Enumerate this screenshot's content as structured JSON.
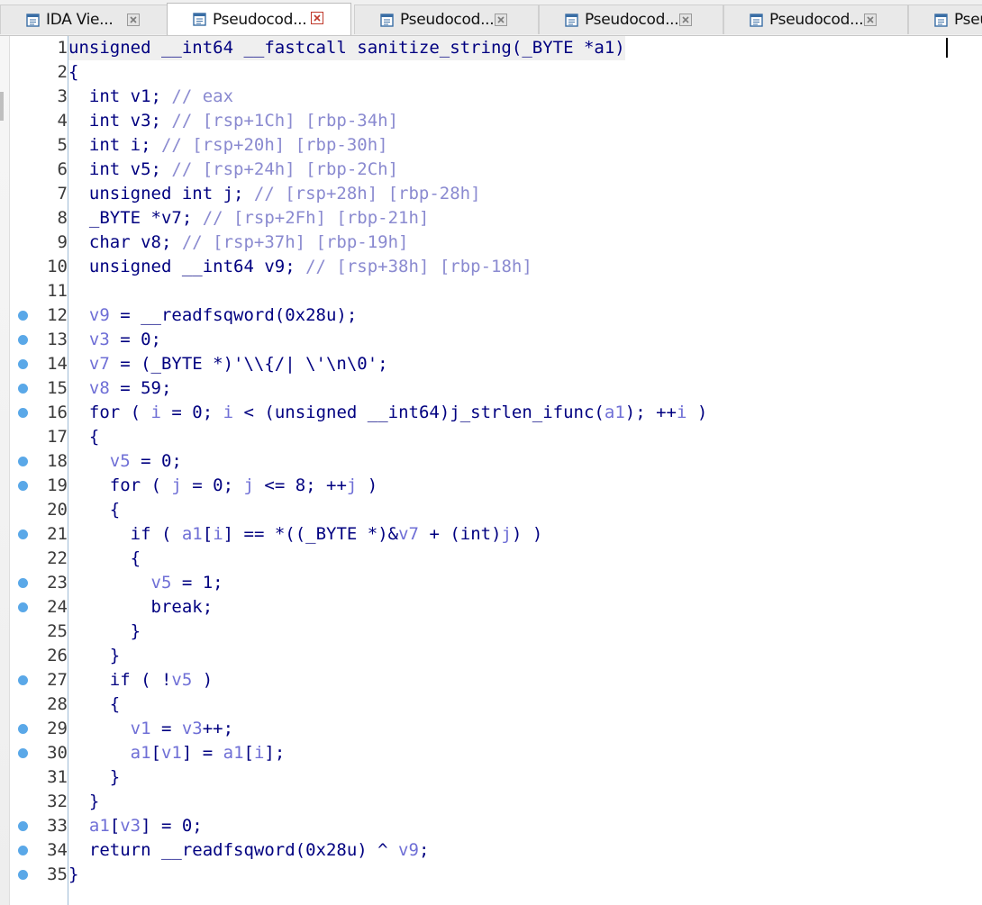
{
  "tabs": [
    {
      "label": "IDA Vie...",
      "active": false
    },
    {
      "label": "Pseudocod...",
      "active": true
    },
    {
      "label": "Pseudocod...",
      "active": false
    },
    {
      "label": "Pseudocod...",
      "active": false
    },
    {
      "label": "Pseudocod...",
      "active": false
    },
    {
      "label": "Pseu",
      "active": false
    }
  ],
  "colors": {
    "code_text": "#000080",
    "comment": "#8a8ad0",
    "variable": "#6f6fd6",
    "breakpoint_dot": "#5aa8e8",
    "active_close_border": "#c0392b"
  },
  "icons": {
    "tab_icon": "pseudocode-window-icon",
    "close": "close-icon",
    "line_marker": "breakpoint-dot-icon"
  },
  "code_lines": [
    {
      "no": "1",
      "dot": false,
      "segs": [
        [
          "k",
          "unsigned __int64 __fastcall sanitize_string(_BYTE *a1)"
        ]
      ]
    },
    {
      "no": "2",
      "dot": false,
      "segs": [
        [
          "p",
          "{"
        ]
      ]
    },
    {
      "no": "3",
      "dot": false,
      "segs": [
        [
          "k",
          "  int v1; "
        ],
        [
          "c",
          "// eax"
        ]
      ]
    },
    {
      "no": "4",
      "dot": false,
      "segs": [
        [
          "k",
          "  int v3; "
        ],
        [
          "c",
          "// [rsp+1Ch] [rbp-34h]"
        ]
      ]
    },
    {
      "no": "5",
      "dot": false,
      "segs": [
        [
          "k",
          "  int i; "
        ],
        [
          "c",
          "// [rsp+20h] [rbp-30h]"
        ]
      ]
    },
    {
      "no": "6",
      "dot": false,
      "segs": [
        [
          "k",
          "  int v5; "
        ],
        [
          "c",
          "// [rsp+24h] [rbp-2Ch]"
        ]
      ]
    },
    {
      "no": "7",
      "dot": false,
      "segs": [
        [
          "k",
          "  unsigned int j; "
        ],
        [
          "c",
          "// [rsp+28h] [rbp-28h]"
        ]
      ]
    },
    {
      "no": "8",
      "dot": false,
      "segs": [
        [
          "k",
          "  _BYTE *v7; "
        ],
        [
          "c",
          "// [rsp+2Fh] [rbp-21h]"
        ]
      ]
    },
    {
      "no": "9",
      "dot": false,
      "segs": [
        [
          "k",
          "  char v8; "
        ],
        [
          "c",
          "// [rsp+37h] [rbp-19h]"
        ]
      ]
    },
    {
      "no": "10",
      "dot": false,
      "segs": [
        [
          "k",
          "  unsigned __int64 v9; "
        ],
        [
          "c",
          "// [rsp+38h] [rbp-18h]"
        ]
      ]
    },
    {
      "no": "11",
      "dot": false,
      "segs": [
        [
          "p",
          ""
        ]
      ]
    },
    {
      "no": "12",
      "dot": true,
      "segs": [
        [
          "v",
          "  v9"
        ],
        [
          "p",
          " = __readfsqword(0x28u);"
        ]
      ]
    },
    {
      "no": "13",
      "dot": true,
      "segs": [
        [
          "v",
          "  v3"
        ],
        [
          "p",
          " = 0;"
        ]
      ]
    },
    {
      "no": "14",
      "dot": true,
      "segs": [
        [
          "v",
          "  v7"
        ],
        [
          "p",
          " = (_BYTE *)'\\\\{/| \\'\\n\\0';"
        ]
      ]
    },
    {
      "no": "15",
      "dot": true,
      "segs": [
        [
          "v",
          "  v8"
        ],
        [
          "p",
          " = 59;"
        ]
      ]
    },
    {
      "no": "16",
      "dot": true,
      "segs": [
        [
          "p",
          "  for ( "
        ],
        [
          "v",
          "i"
        ],
        [
          "p",
          " = 0; "
        ],
        [
          "v",
          "i"
        ],
        [
          "p",
          " < (unsigned __int64)j_strlen_ifunc("
        ],
        [
          "v",
          "a1"
        ],
        [
          "p",
          "); ++"
        ],
        [
          "v",
          "i"
        ],
        [
          "p",
          " )"
        ]
      ]
    },
    {
      "no": "17",
      "dot": false,
      "segs": [
        [
          "p",
          "  {"
        ]
      ]
    },
    {
      "no": "18",
      "dot": true,
      "segs": [
        [
          "v",
          "    v5"
        ],
        [
          "p",
          " = 0;"
        ]
      ]
    },
    {
      "no": "19",
      "dot": true,
      "segs": [
        [
          "p",
          "    for ( "
        ],
        [
          "v",
          "j"
        ],
        [
          "p",
          " = 0; "
        ],
        [
          "v",
          "j"
        ],
        [
          "p",
          " <= 8; ++"
        ],
        [
          "v",
          "j"
        ],
        [
          "p",
          " )"
        ]
      ]
    },
    {
      "no": "20",
      "dot": false,
      "segs": [
        [
          "p",
          "    {"
        ]
      ]
    },
    {
      "no": "21",
      "dot": true,
      "segs": [
        [
          "p",
          "      if ( "
        ],
        [
          "v",
          "a1"
        ],
        [
          "p",
          "["
        ],
        [
          "v",
          "i"
        ],
        [
          "p",
          "] == *((_BYTE *)&"
        ],
        [
          "v",
          "v7"
        ],
        [
          "p",
          " + (int)"
        ],
        [
          "v",
          "j"
        ],
        [
          "p",
          ") )"
        ]
      ]
    },
    {
      "no": "22",
      "dot": false,
      "segs": [
        [
          "p",
          "      {"
        ]
      ]
    },
    {
      "no": "23",
      "dot": true,
      "segs": [
        [
          "v",
          "        v5"
        ],
        [
          "p",
          " = 1;"
        ]
      ]
    },
    {
      "no": "24",
      "dot": true,
      "segs": [
        [
          "p",
          "        break;"
        ]
      ]
    },
    {
      "no": "25",
      "dot": false,
      "segs": [
        [
          "p",
          "      }"
        ]
      ]
    },
    {
      "no": "26",
      "dot": false,
      "segs": [
        [
          "p",
          "    }"
        ]
      ]
    },
    {
      "no": "27",
      "dot": true,
      "segs": [
        [
          "p",
          "    if ( !"
        ],
        [
          "v",
          "v5"
        ],
        [
          "p",
          " )"
        ]
      ]
    },
    {
      "no": "28",
      "dot": false,
      "segs": [
        [
          "p",
          "    {"
        ]
      ]
    },
    {
      "no": "29",
      "dot": true,
      "segs": [
        [
          "v",
          "      v1"
        ],
        [
          "p",
          " = "
        ],
        [
          "v",
          "v3"
        ],
        [
          "p",
          "++;"
        ]
      ]
    },
    {
      "no": "30",
      "dot": true,
      "segs": [
        [
          "v",
          "      a1"
        ],
        [
          "p",
          "["
        ],
        [
          "v",
          "v1"
        ],
        [
          "p",
          "] = "
        ],
        [
          "v",
          "a1"
        ],
        [
          "p",
          "["
        ],
        [
          "v",
          "i"
        ],
        [
          "p",
          "];"
        ]
      ]
    },
    {
      "no": "31",
      "dot": false,
      "segs": [
        [
          "p",
          "    }"
        ]
      ]
    },
    {
      "no": "32",
      "dot": false,
      "segs": [
        [
          "p",
          "  }"
        ]
      ]
    },
    {
      "no": "33",
      "dot": true,
      "segs": [
        [
          "v",
          "  a1"
        ],
        [
          "p",
          "["
        ],
        [
          "v",
          "v3"
        ],
        [
          "p",
          "] = 0;"
        ]
      ]
    },
    {
      "no": "34",
      "dot": true,
      "segs": [
        [
          "p",
          "  return __readfsqword(0x28u) ^ "
        ],
        [
          "v",
          "v9"
        ],
        [
          "p",
          ";"
        ]
      ]
    },
    {
      "no": "35",
      "dot": true,
      "segs": [
        [
          "p",
          "}"
        ]
      ]
    }
  ]
}
